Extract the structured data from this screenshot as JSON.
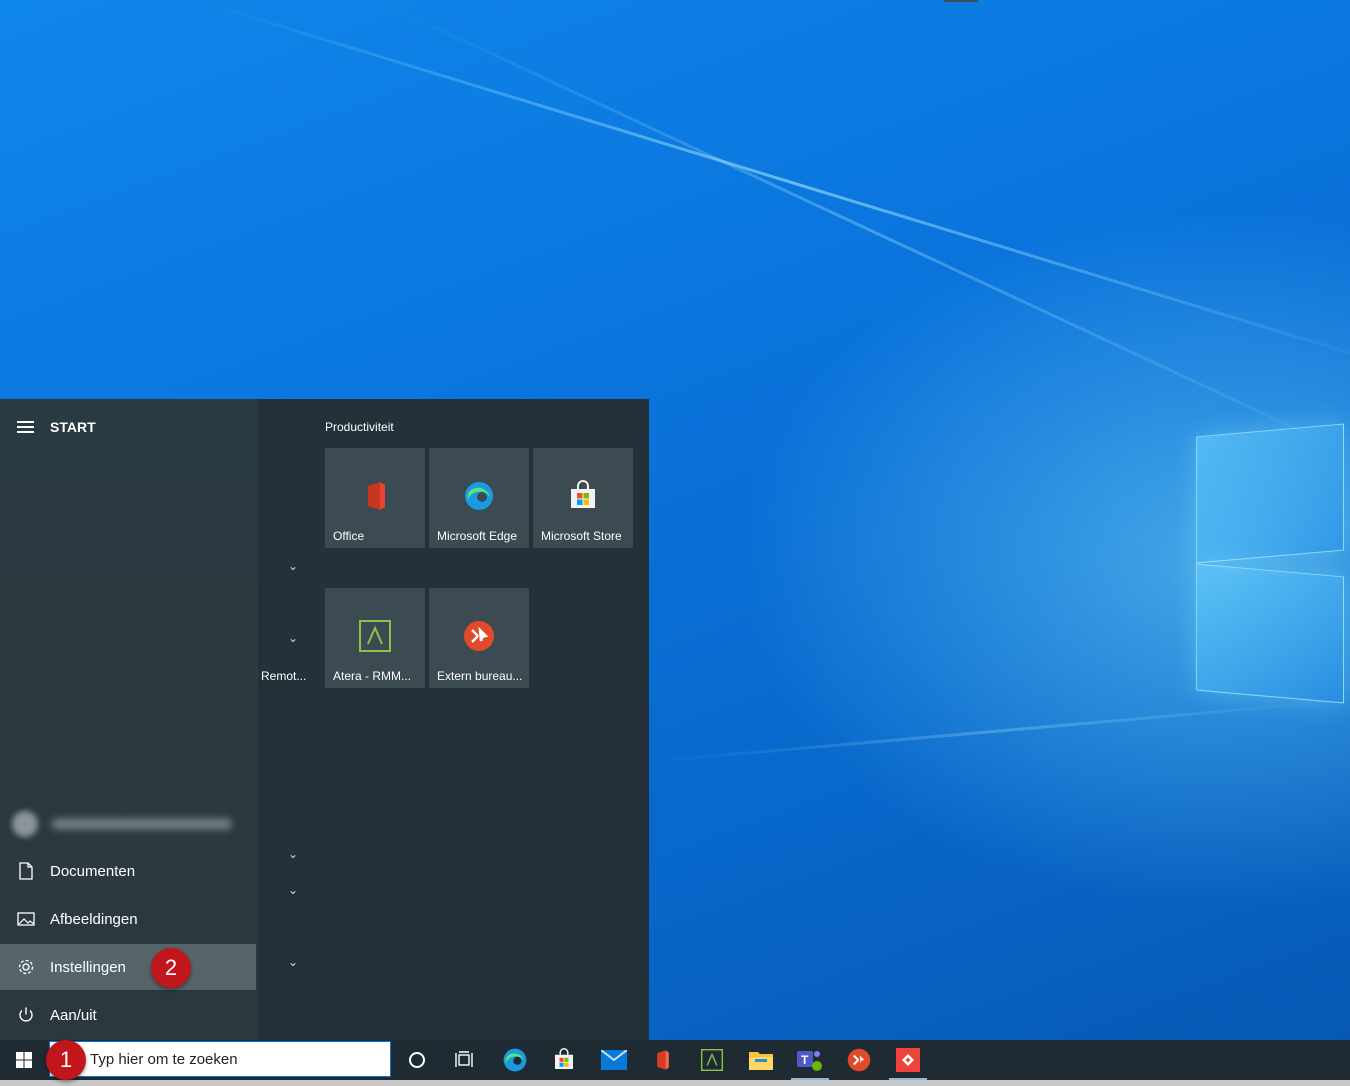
{
  "start_menu": {
    "title": "START",
    "group_title": "Productiviteit",
    "middle_label": "Remot...",
    "nav": [
      {
        "label": "Documenten",
        "icon": "document-icon"
      },
      {
        "label": "Afbeeldingen",
        "icon": "pictures-icon"
      },
      {
        "label": "Instellingen",
        "icon": "gear-icon"
      },
      {
        "label": "Aan/uit",
        "icon": "power-icon"
      }
    ],
    "tiles": [
      {
        "label": "Office",
        "icon": "office-icon"
      },
      {
        "label": "Microsoft Edge",
        "icon": "edge-icon"
      },
      {
        "label": "Microsoft Store",
        "icon": "store-icon"
      },
      {
        "label": "Atera - RMM...",
        "icon": "atera-icon"
      },
      {
        "label": "Extern bureau...",
        "icon": "remote-desktop-icon"
      }
    ]
  },
  "badges": {
    "search": "1",
    "settings": "2"
  },
  "taskbar": {
    "search_placeholder": "Typ hier om te zoeken",
    "icons": [
      "windows-start-icon",
      "cortana-icon",
      "task-view-icon",
      "edge-icon",
      "store-icon",
      "mail-icon",
      "office-icon",
      "atera-icon",
      "file-explorer-icon",
      "teams-icon",
      "remote-desktop-icon",
      "anydesk-icon"
    ]
  },
  "colors": {
    "accent": "#0078d7",
    "badge": "#c0161c",
    "start_bg": "#22313a",
    "tile_bg": "#3c4a51"
  }
}
